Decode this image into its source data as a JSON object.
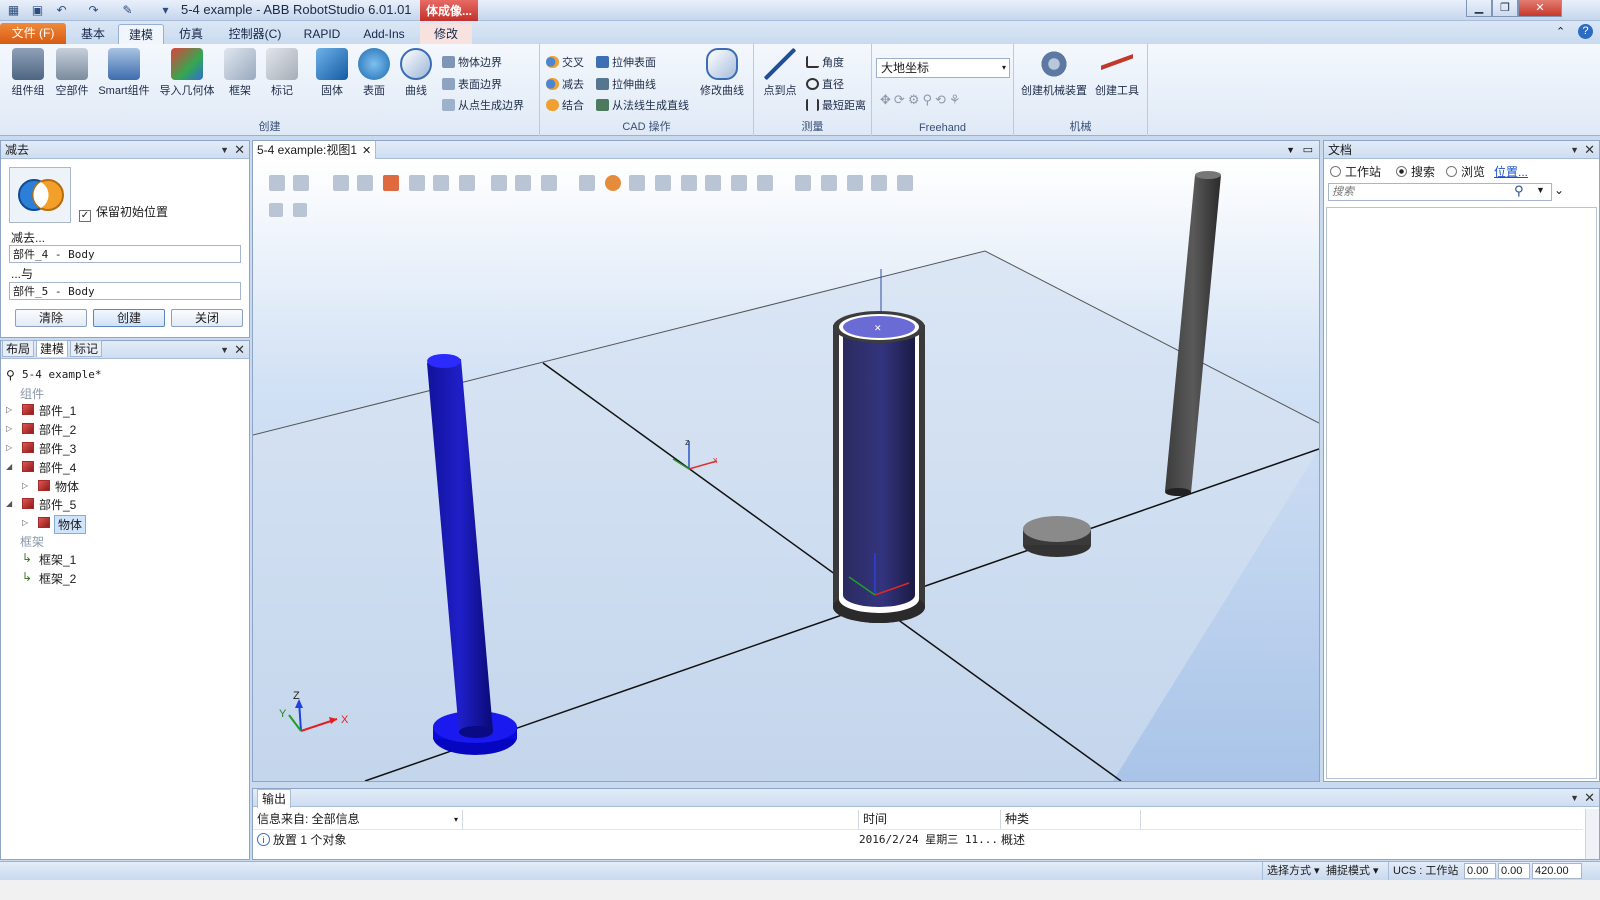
{
  "window": {
    "title": "5-4 example - ABB RobotStudio 6.01.01",
    "context_tab": "体成像...",
    "colors": {
      "accent": "#d85a12",
      "brand": "#2b5797",
      "context": "#c2302b"
    }
  },
  "ribbon": {
    "file_tab": "文件 (F)",
    "tabs": [
      "基本",
      "建模",
      "仿真",
      "控制器(C)",
      "RAPID",
      "Add-Ins",
      "修改"
    ],
    "active_tab": "建模",
    "groups": {
      "create": {
        "label": "创建",
        "buttons": [
          "组件组",
          "空部件",
          "Smart组件",
          "导入几何体",
          "框架",
          "标记",
          "固体",
          "表面",
          "曲线"
        ],
        "small": [
          "物体边界",
          "表面边界",
          "从点生成边界"
        ]
      },
      "cad": {
        "label": "CAD 操作",
        "small": [
          "交叉",
          "减去",
          "结合",
          "拉伸表面",
          "拉伸曲线",
          "从法线生成直线"
        ],
        "big": "修改曲线"
      },
      "measure": {
        "label": "测量",
        "big": "点到点",
        "small": [
          "角度",
          "直径",
          "最短距离"
        ]
      },
      "freehand": {
        "label": "Freehand",
        "select": "大地坐标"
      },
      "mechanism": {
        "label": "机械",
        "buttons": [
          "创建机械装置",
          "创建工具"
        ]
      }
    }
  },
  "subtract_panel": {
    "title": "减去",
    "keep_position_label": "保留初始位置",
    "keep_position_checked": true,
    "subtract_label": "减去...",
    "subtract_value": "部件_4 - Body",
    "with_label": "...与",
    "with_value": "部件_5 - Body",
    "buttons": {
      "clear": "清除",
      "create": "创建",
      "close": "关闭"
    }
  },
  "layout_panel": {
    "tabs": [
      "布局",
      "建模",
      "标记"
    ],
    "active_tab": "建模",
    "root": "5-4 example*",
    "components_header": "组件",
    "parts": [
      {
        "label": "部件_1",
        "expanded": false
      },
      {
        "label": "部件_2",
        "expanded": false
      },
      {
        "label": "部件_3",
        "expanded": false
      },
      {
        "label": "部件_4",
        "expanded": true,
        "child": "物体"
      },
      {
        "label": "部件_5",
        "expanded": true,
        "child": "物体",
        "selected": true
      }
    ],
    "frames_header": "框架",
    "frames": [
      "框架_1",
      "框架_2"
    ]
  },
  "viewport": {
    "tab": "5-4 example:视图1",
    "axes": {
      "x": "X",
      "y": "Y",
      "z": "Z"
    }
  },
  "docs_panel": {
    "title": "文档",
    "radios": [
      "工作站",
      "搜索",
      "浏览"
    ],
    "selected_radio": "搜索",
    "location_link": "位置...",
    "search_placeholder": "搜索"
  },
  "output": {
    "title": "输出",
    "source_label": "信息来自: 全部信息",
    "columns": {
      "time": "时间",
      "type": "种类"
    },
    "rows": [
      {
        "message": "放置 1 个对象",
        "time": "2016/2/24 星期三 11...",
        "type": "概述"
      }
    ]
  },
  "statusbar": {
    "select_mode": "选择方式",
    "snap_mode": "捕捉模式",
    "ucs": "UCS : 工作站",
    "coord_x": "0.00",
    "coord_y": "0.00",
    "coord_z": "420.00"
  }
}
